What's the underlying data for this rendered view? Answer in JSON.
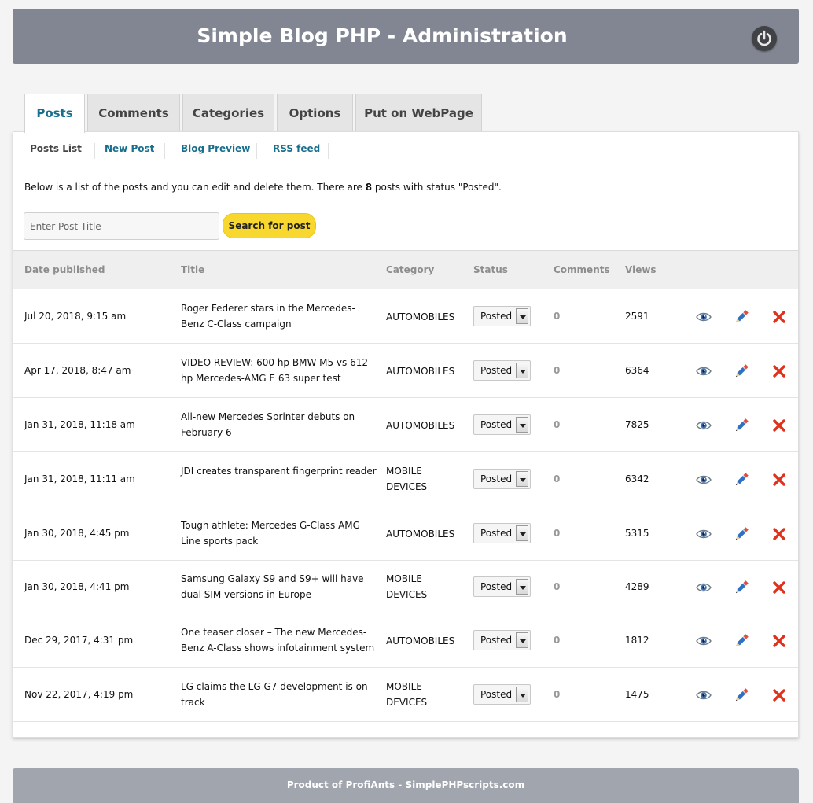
{
  "header": {
    "title": "Simple Blog PHP - Administration",
    "icon": "power-icon"
  },
  "tabs": [
    {
      "label": "Posts",
      "active": true
    },
    {
      "label": "Comments",
      "active": false
    },
    {
      "label": "Categories",
      "active": false
    },
    {
      "label": "Options",
      "active": false
    },
    {
      "label": "Put on WebPage",
      "active": false
    }
  ],
  "subnav": [
    {
      "label": "Posts List",
      "current": true
    },
    {
      "label": "New Post",
      "current": false
    },
    {
      "label": "Blog Preview",
      "current": false
    },
    {
      "label": "RSS feed",
      "current": false
    }
  ],
  "intro": {
    "before": "Below is a list of the posts and you can edit and delete them. There are ",
    "count": "8",
    "after": " posts with status \"Posted\"."
  },
  "search": {
    "placeholder": "Enter Post Title",
    "value": "",
    "button_label": "Search for post"
  },
  "table": {
    "columns": [
      "Date published",
      "Title",
      "Category",
      "Status",
      "Comments",
      "Views"
    ],
    "rows": [
      {
        "date": "Jul 20, 2018, 9:15 am",
        "title": "Roger Federer stars in the Mercedes-Benz C-Class campaign",
        "category": "AUTOMOBILES",
        "status": "Posted",
        "comments": "0",
        "views": "2591"
      },
      {
        "date": "Apr 17, 2018, 8:47 am",
        "title": "VIDEO REVIEW: 600 hp BMW M5 vs 612 hp Mercedes-AMG E 63 super test",
        "category": "AUTOMOBILES",
        "status": "Posted",
        "comments": "0",
        "views": "6364"
      },
      {
        "date": "Jan 31, 2018, 11:18 am",
        "title": "All-new Mercedes Sprinter debuts on February 6",
        "category": "AUTOMOBILES",
        "status": "Posted",
        "comments": "0",
        "views": "7825"
      },
      {
        "date": "Jan 31, 2018, 11:11 am",
        "title": "JDI creates transparent fingerprint reader",
        "category": "MOBILE DEVICES",
        "status": "Posted",
        "comments": "0",
        "views": "6342"
      },
      {
        "date": "Jan 30, 2018, 4:45 pm",
        "title": "Tough athlete: Mercedes G-Class AMG Line sports pack",
        "category": "AUTOMOBILES",
        "status": "Posted",
        "comments": "0",
        "views": "5315"
      },
      {
        "date": "Jan 30, 2018, 4:41 pm",
        "title": "Samsung Galaxy S9 and S9+ will have dual SIM versions in Europe",
        "category": "MOBILE DEVICES",
        "status": "Posted",
        "comments": "0",
        "views": "4289"
      },
      {
        "date": "Dec 29, 2017, 4:31 pm",
        "title": "One teaser closer – The new Mercedes-Benz A-Class shows infotainment system",
        "category": "AUTOMOBILES",
        "status": "Posted",
        "comments": "0",
        "views": "1812"
      },
      {
        "date": "Nov 22, 2017, 4:19 pm",
        "title": "LG claims the LG G7 development is on track",
        "category": "MOBILE DEVICES",
        "status": "Posted",
        "comments": "0",
        "views": "1475"
      }
    ],
    "actions": [
      "view-icon",
      "edit-icon",
      "delete-icon"
    ]
  },
  "footer": {
    "text": "Product of ProfiAnts - SimplePHPscripts.com"
  },
  "colors": {
    "header_bg": "#828692",
    "accent": "#186e8d",
    "search_button": "#f8d82f",
    "delete": "#e0311b"
  }
}
